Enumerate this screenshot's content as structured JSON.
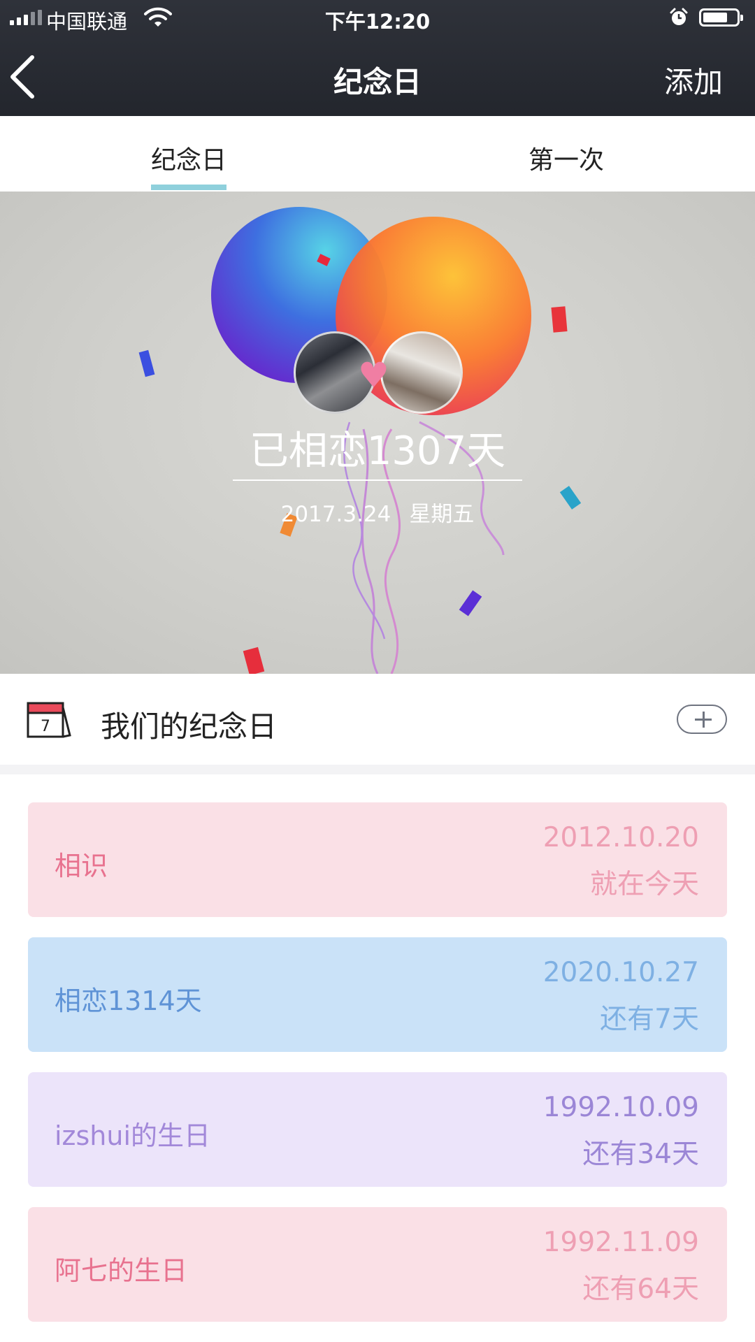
{
  "status": {
    "carrier": "中国联通",
    "time": "下午12:20"
  },
  "nav": {
    "title": "纪念日",
    "add_label": "添加"
  },
  "tabs": [
    {
      "label": "纪念日",
      "active": true
    },
    {
      "label": "第一次",
      "active": false
    }
  ],
  "hero": {
    "title": "已相恋1307天",
    "date": "2017.3.24",
    "weekday": "星期五"
  },
  "section": {
    "title": "我们的纪念日",
    "calendar_day": "7"
  },
  "cards": [
    {
      "name": "相识",
      "date": "2012.10.20",
      "note": "就在今天",
      "bg": "#fae0e6",
      "name_color": "#e8728f",
      "info_color": "#ee9fb3"
    },
    {
      "name": "相恋1314天",
      "date": "2020.10.27",
      "note": "还有7天",
      "bg": "#cae2f8",
      "name_color": "#5f93d6",
      "info_color": "#7eb0e3"
    },
    {
      "name": "izshui的生日",
      "date": "1992.10.09",
      "note": "还有34天",
      "bg": "#ece4fa",
      "name_color": "#a288d9",
      "info_color": "#9b86d6"
    },
    {
      "name": "阿七的生日",
      "date": "1992.11.09",
      "note": "还有64天",
      "bg": "#fae0e6",
      "name_color": "#e8728f",
      "info_color": "#ee9fb3"
    }
  ]
}
